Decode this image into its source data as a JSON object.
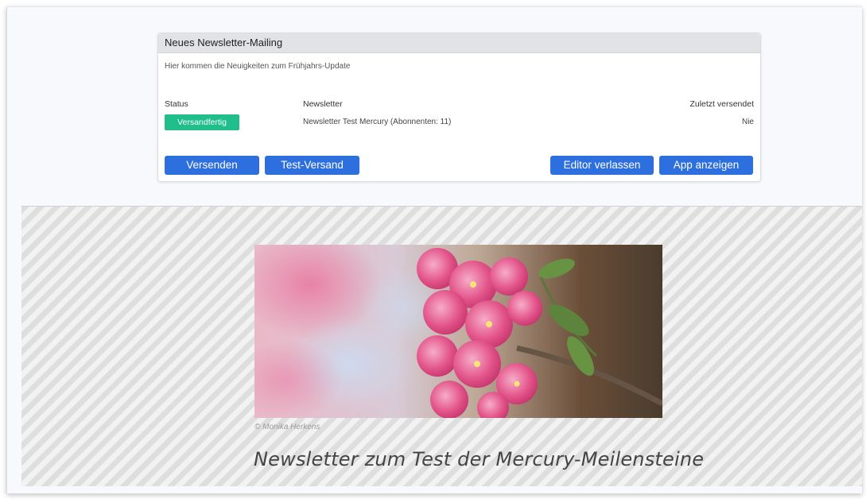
{
  "mailing": {
    "title": "Neues Newsletter-Mailing",
    "subject": "Hier kommen die Neuigkeiten zum Frühjahrs-Update",
    "columns": {
      "status": "Status",
      "newsletter": "Newsletter",
      "last_sent": "Zuletzt versendet"
    },
    "status_value": "Versandfertig",
    "newsletter_value": "Newsletter Test Mercury (Abonnenten: 11)",
    "last_sent_value": "Nie",
    "buttons": {
      "send": "Versenden",
      "test_send": "Test-Versand",
      "leave_editor": "Editor verlassen",
      "show_app": "App anzeigen"
    }
  },
  "preview": {
    "image_credit": "© Monika Herkens",
    "headline": "Newsletter zum Test der Mercury-Meilensteine"
  },
  "colors": {
    "accent_button": "#2e6fe0",
    "status_badge": "#1fbe8a",
    "panel_header": "#e2e3e7"
  },
  "icons": {
    "hero_image": "pink-blossom-branch-image"
  }
}
